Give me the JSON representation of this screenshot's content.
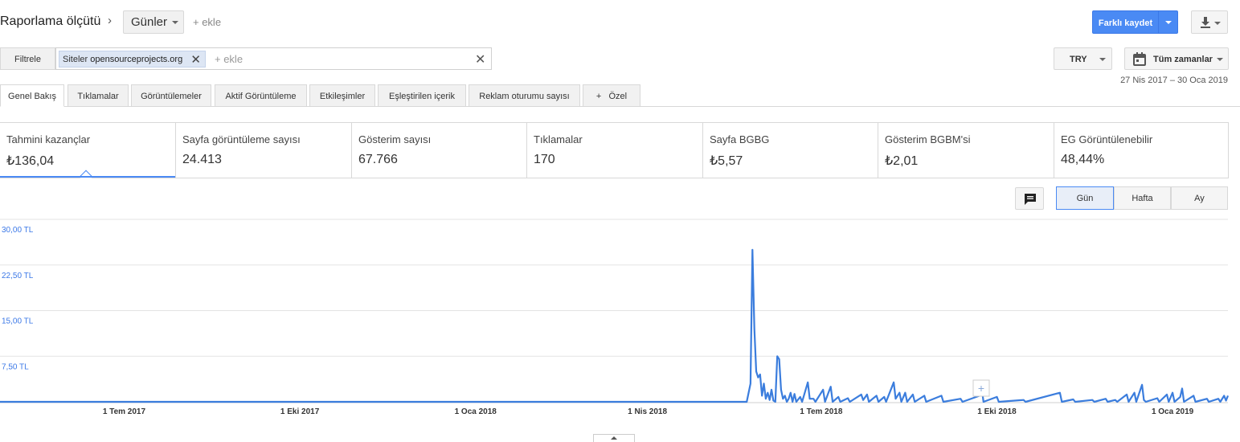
{
  "header": {
    "title": "Raporlama ölçütü",
    "dimension": "Günler",
    "add_label": "+ ekle",
    "save_label": "Farklı kaydet"
  },
  "filter": {
    "label": "Filtrele",
    "chip_key": "Siteler",
    "chip_value": "opensourceprojects.org",
    "add_label": "+ ekle"
  },
  "controls": {
    "currency": "TRY",
    "range": "Tüm zamanlar",
    "date_range": "27 Nis 2017 – 30 Oca 2019"
  },
  "tabs": [
    {
      "label": "Genel Bakış",
      "active": true
    },
    {
      "label": "Tıklamalar",
      "active": false
    },
    {
      "label": "Görüntülemeler",
      "active": false
    },
    {
      "label": "Aktif Görüntüleme",
      "active": false
    },
    {
      "label": "Etkileşimler",
      "active": false
    },
    {
      "label": "Eşleştirilen içerik",
      "active": false
    },
    {
      "label": "Reklam oturumu sayısı",
      "active": false
    },
    {
      "label": "+   Özel",
      "active": false
    }
  ],
  "metrics": [
    {
      "label": "Tahmini kazançlar",
      "value": "₺136,04"
    },
    {
      "label": "Sayfa görüntüleme sayısı",
      "value": "24.413"
    },
    {
      "label": "Gösterim sayısı",
      "value": "67.766"
    },
    {
      "label": "Tıklamalar",
      "value": "170"
    },
    {
      "label": "Sayfa BGBG",
      "value": "₺5,57"
    },
    {
      "label": "Gösterim BGBM'si",
      "value": "₺2,01"
    },
    {
      "label": "EG Görüntülenebilir",
      "value": "48,44%"
    }
  ],
  "granularity": [
    {
      "label": "Gün",
      "active": true
    },
    {
      "label": "Hafta",
      "active": false
    },
    {
      "label": "Ay",
      "active": false
    }
  ],
  "icons": {
    "download": "download-icon",
    "calendar": "calendar-icon",
    "annotation": "comment-icon",
    "close": "close-icon"
  },
  "colors": {
    "accent": "#4a8af4",
    "line": "#3b7ddd"
  },
  "chart_data": {
    "type": "line",
    "title": "",
    "xlabel": "",
    "ylabel": "",
    "ylim": [
      0,
      30
    ],
    "y_ticks": [
      "30,00 TL",
      "22,50 TL",
      "15,00 TL",
      "7,50 TL"
    ],
    "x_ticks": [
      "1 Tem 2017",
      "1 Eki 2017",
      "1 Oca 2018",
      "1 Nis 2018",
      "1 Tem 2018",
      "1 Eki 2018",
      "1 Oca 2019"
    ],
    "x_start": "2017-04-27",
    "x_end": "2019-01-30",
    "grid": true,
    "series": [
      {
        "values": [
          [
            "2017-04-27",
            0
          ],
          [
            "2018-05-23",
            0
          ],
          [
            "2018-05-25",
            3
          ],
          [
            "2018-05-26",
            25
          ],
          [
            "2018-05-27",
            12
          ],
          [
            "2018-05-28",
            5
          ],
          [
            "2018-05-29",
            4
          ],
          [
            "2018-05-30",
            4.5
          ],
          [
            "2018-05-31",
            1
          ],
          [
            "2018-06-01",
            3
          ],
          [
            "2018-06-02",
            0.5
          ],
          [
            "2018-06-03",
            1.5
          ],
          [
            "2018-06-04",
            0.3
          ],
          [
            "2018-06-05",
            2
          ],
          [
            "2018-06-06",
            0.2
          ],
          [
            "2018-06-07",
            0
          ],
          [
            "2018-06-08",
            7.5
          ],
          [
            "2018-06-09",
            7
          ],
          [
            "2018-06-10",
            2
          ],
          [
            "2018-06-11",
            0.5
          ],
          [
            "2018-06-12",
            1
          ],
          [
            "2018-06-13",
            0
          ],
          [
            "2018-06-14",
            0.5
          ],
          [
            "2018-06-15",
            1.5
          ],
          [
            "2018-06-16",
            0
          ],
          [
            "2018-06-17",
            1.3
          ],
          [
            "2018-06-18",
            0
          ],
          [
            "2018-06-20",
            0.8
          ],
          [
            "2018-06-21",
            0
          ],
          [
            "2018-06-24",
            3.2
          ],
          [
            "2018-06-25",
            0.5
          ],
          [
            "2018-06-27",
            0.5
          ],
          [
            "2018-06-28",
            0
          ],
          [
            "2018-07-02",
            2
          ],
          [
            "2018-07-03",
            0
          ],
          [
            "2018-07-06",
            2.5
          ],
          [
            "2018-07-07",
            0
          ],
          [
            "2018-07-10",
            0.8
          ],
          [
            "2018-07-11",
            0
          ],
          [
            "2018-07-15",
            0.6
          ],
          [
            "2018-07-16",
            0
          ],
          [
            "2018-07-22",
            1.2
          ],
          [
            "2018-07-23",
            0.3
          ],
          [
            "2018-07-25",
            1.2
          ],
          [
            "2018-07-26",
            0
          ],
          [
            "2018-07-30",
            1
          ],
          [
            "2018-07-31",
            0
          ],
          [
            "2018-08-03",
            0.8
          ],
          [
            "2018-08-04",
            0
          ],
          [
            "2018-08-08",
            3.2
          ],
          [
            "2018-08-09",
            0.5
          ],
          [
            "2018-08-11",
            1.5
          ],
          [
            "2018-08-12",
            0
          ],
          [
            "2018-08-14",
            1.5
          ],
          [
            "2018-08-15",
            0
          ],
          [
            "2018-08-18",
            1.2
          ],
          [
            "2018-08-19",
            0
          ],
          [
            "2018-08-24",
            1
          ],
          [
            "2018-08-25",
            0
          ],
          [
            "2018-09-02",
            1
          ],
          [
            "2018-09-03",
            0
          ],
          [
            "2018-09-12",
            0.5
          ],
          [
            "2018-09-13",
            0
          ],
          [
            "2018-09-22",
            1
          ],
          [
            "2018-09-23",
            2.5
          ],
          [
            "2018-09-24",
            0
          ],
          [
            "2018-10-01",
            0.8
          ],
          [
            "2018-10-02",
            0
          ],
          [
            "2018-10-15",
            0.3
          ],
          [
            "2018-10-16",
            0
          ],
          [
            "2018-11-03",
            1.5
          ],
          [
            "2018-11-04",
            0
          ],
          [
            "2018-11-10",
            0.4
          ],
          [
            "2018-11-11",
            0
          ],
          [
            "2018-11-20",
            0.3
          ],
          [
            "2018-11-21",
            0
          ],
          [
            "2018-11-27",
            0.5
          ],
          [
            "2018-11-28",
            0
          ],
          [
            "2018-12-02",
            0.3
          ],
          [
            "2018-12-03",
            0
          ],
          [
            "2018-12-08",
            1.2
          ],
          [
            "2018-12-09",
            0
          ],
          [
            "2018-12-12",
            1.5
          ],
          [
            "2018-12-13",
            0
          ],
          [
            "2018-12-16",
            2.8
          ],
          [
            "2018-12-17",
            0.3
          ],
          [
            "2018-12-18",
            0
          ],
          [
            "2018-12-24",
            0.6
          ],
          [
            "2018-12-25",
            0
          ],
          [
            "2018-12-29",
            1.2
          ],
          [
            "2018-12-30",
            0
          ],
          [
            "2019-01-01",
            1.5
          ],
          [
            "2019-01-02",
            0
          ],
          [
            "2019-01-05",
            0.8
          ],
          [
            "2019-01-06",
            2.2
          ],
          [
            "2019-01-07",
            0
          ],
          [
            "2019-01-12",
            1
          ],
          [
            "2019-01-13",
            0
          ],
          [
            "2019-01-19",
            0.5
          ],
          [
            "2019-01-20",
            0
          ],
          [
            "2019-01-25",
            0.5
          ],
          [
            "2019-01-26",
            0
          ],
          [
            "2019-01-28",
            1
          ],
          [
            "2019-01-29",
            0.2
          ],
          [
            "2019-01-30",
            1
          ]
        ]
      }
    ]
  }
}
